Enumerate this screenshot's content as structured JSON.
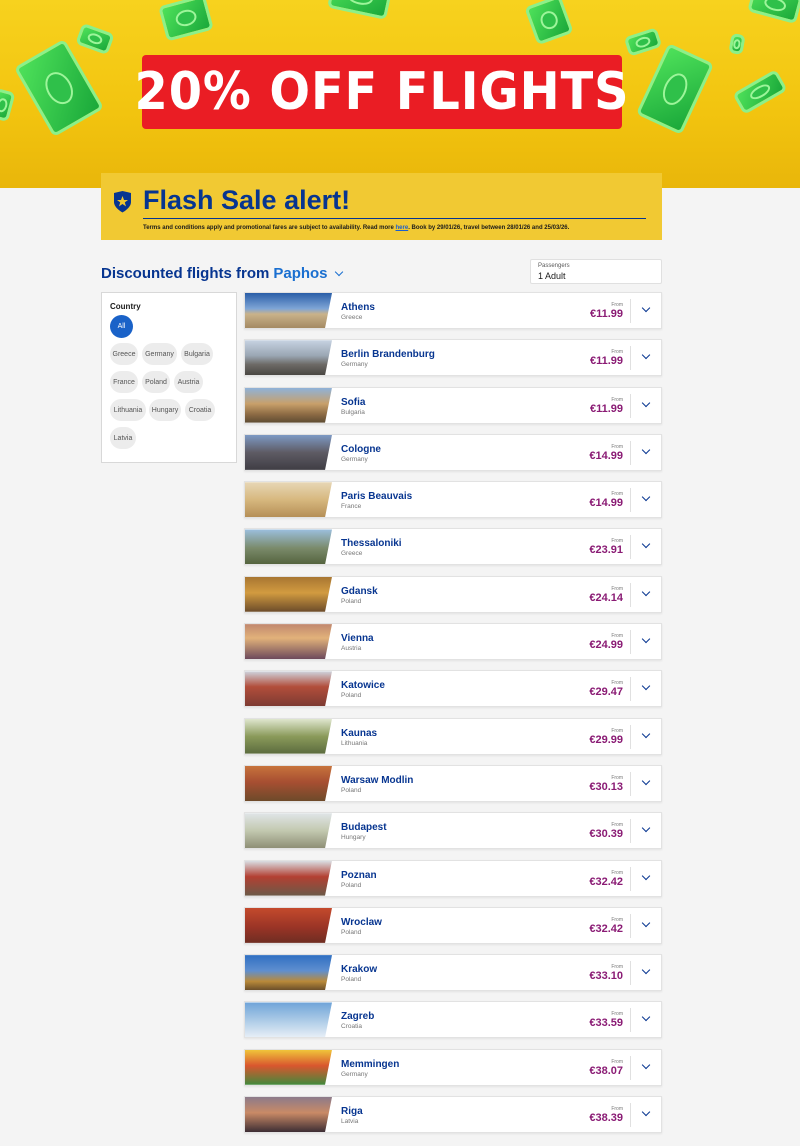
{
  "hero": {
    "promo_text": "20% OFF FLIGHTS"
  },
  "alert": {
    "title": "Flash Sale alert!",
    "terms_before": "Terms and conditions apply and promotional fares are subject to availability. Read more ",
    "terms_link": "here",
    "terms_after": ". Book by 29/01/26, travel between 28/01/26 and 25/03/26."
  },
  "heading": {
    "prefix": "Discounted flights from",
    "city": "Paphos"
  },
  "passengers": {
    "label": "Passengers",
    "value": "1 Adult"
  },
  "filter": {
    "title": "Country",
    "chips": [
      "All",
      "Greece",
      "Germany",
      "Bulgaria",
      "France",
      "Poland",
      "Austria",
      "Lithuania",
      "Hungary",
      "Croatia",
      "Latvia"
    ]
  },
  "from_label": "From",
  "flights": [
    {
      "city": "Athens",
      "country": "Greece",
      "price": "€11.99"
    },
    {
      "city": "Berlin Brandenburg",
      "country": "Germany",
      "price": "€11.99"
    },
    {
      "city": "Sofia",
      "country": "Bulgaria",
      "price": "€11.99"
    },
    {
      "city": "Cologne",
      "country": "Germany",
      "price": "€14.99"
    },
    {
      "city": "Paris Beauvais",
      "country": "France",
      "price": "€14.99"
    },
    {
      "city": "Thessaloniki",
      "country": "Greece",
      "price": "€23.91"
    },
    {
      "city": "Gdansk",
      "country": "Poland",
      "price": "€24.14"
    },
    {
      "city": "Vienna",
      "country": "Austria",
      "price": "€24.99"
    },
    {
      "city": "Katowice",
      "country": "Poland",
      "price": "€29.47"
    },
    {
      "city": "Kaunas",
      "country": "Lithuania",
      "price": "€29.99"
    },
    {
      "city": "Warsaw Modlin",
      "country": "Poland",
      "price": "€30.13"
    },
    {
      "city": "Budapest",
      "country": "Hungary",
      "price": "€30.39"
    },
    {
      "city": "Poznan",
      "country": "Poland",
      "price": "€32.42"
    },
    {
      "city": "Wroclaw",
      "country": "Poland",
      "price": "€32.42"
    },
    {
      "city": "Krakow",
      "country": "Poland",
      "price": "€33.10"
    },
    {
      "city": "Zagreb",
      "country": "Croatia",
      "price": "€33.59"
    },
    {
      "city": "Memmingen",
      "country": "Germany",
      "price": "€38.07"
    },
    {
      "city": "Riga",
      "country": "Latvia",
      "price": "€38.39"
    }
  ],
  "colors": {
    "brand_blue": "#073590",
    "brand_yellow": "#f1c933",
    "promo_red": "#ea1d24",
    "price_purple": "#8a1b74",
    "chip_active": "#1a62c8"
  }
}
